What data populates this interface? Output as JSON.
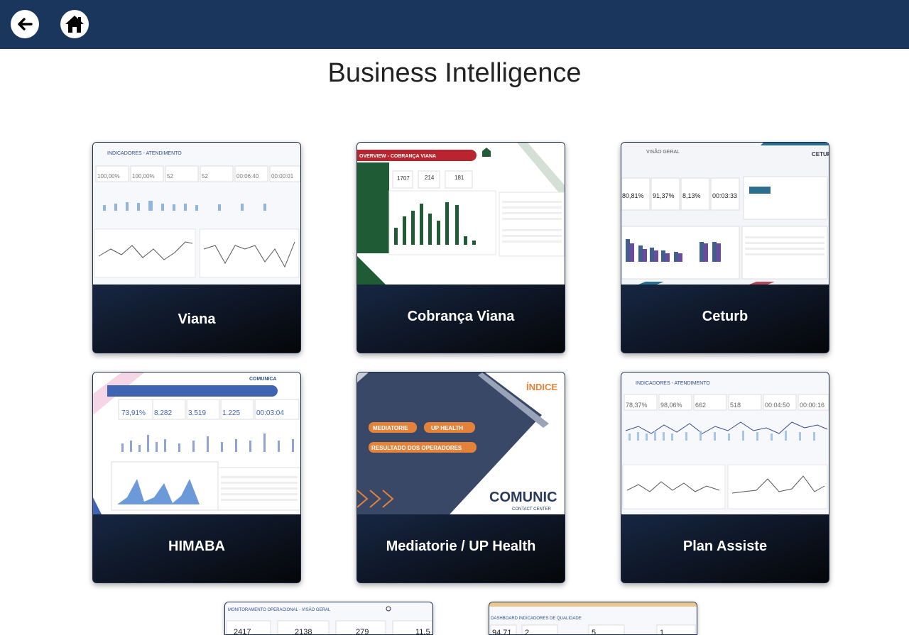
{
  "header": {
    "back_icon": "arrow-left-icon",
    "home_icon": "home-icon",
    "bg_color": "#1b365d"
  },
  "page": {
    "title": "Business Intelligence"
  },
  "cards": [
    {
      "label": "Viana",
      "thumb_title": "INDICADORES - ATENDIMENTO",
      "kpis": [
        "100,00%",
        "100,00%",
        "52",
        "52",
        "00:06:40",
        "00:00:01"
      ]
    },
    {
      "label": "Cobrança Viana",
      "thumb_title": "OVERVIEW - COBRANÇA VIANA",
      "kpis": [
        "1707",
        "214",
        "181"
      ]
    },
    {
      "label": "Ceturb",
      "thumb_title": "VISÃO GERAL",
      "brand": "CETURB",
      "kpis": [
        "80,81%",
        "91,37%",
        "8,13%",
        "00:03:33"
      ]
    },
    {
      "label": "HIMABA",
      "thumb_title": "COMUNICA",
      "kpis": [
        "73,91%",
        "8.282",
        "3.519",
        "1.225",
        "00:03:04"
      ]
    },
    {
      "label": "Mediatorie / UP Health",
      "thumb_title": "ÍNDICE",
      "tags": [
        "MEDIATORIE",
        "UP HEALTH",
        "RESULTADO DOS OPERADORES"
      ],
      "brand": "COMUNIC",
      "brand_sub": "CONTACT CENTER"
    },
    {
      "label": "Plan Assiste",
      "thumb_title": "INDICADORES - ATENDIMENTO",
      "kpis": [
        "78,37%",
        "98,06%",
        "662",
        "518",
        "00:04:50",
        "00:00:16"
      ]
    },
    {
      "label": "",
      "thumb_title": "MONITORAMENTO OPERACIONAL - VISÃO GERAL",
      "kpis": [
        "2417",
        "2138",
        "279",
        "11,5"
      ]
    },
    {
      "label": "",
      "thumb_title": "DASHBOARD INDICADORES DE QUALIDADE",
      "kpis": [
        "94,71",
        "2",
        "5",
        "1"
      ]
    }
  ]
}
